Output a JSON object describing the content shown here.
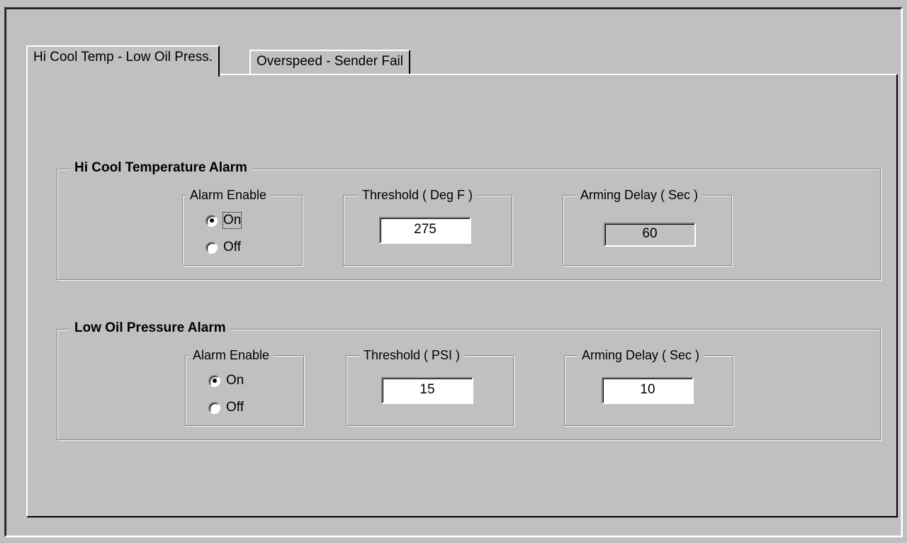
{
  "tabs": [
    {
      "label": "Hi Cool Temp - Low Oil Press.",
      "active": true
    },
    {
      "label": "Overspeed - Sender Fail",
      "active": false
    }
  ],
  "groups": {
    "hi_cool": {
      "title": "Hi Cool Temperature Alarm",
      "alarm_enable": {
        "label": "Alarm Enable",
        "on_label": "On",
        "off_label": "Off",
        "selected": "On"
      },
      "threshold": {
        "label": "Threshold ( Deg F )",
        "value": "275"
      },
      "arming_delay": {
        "label": "Arming Delay ( Sec )",
        "value": "60",
        "enabled": false
      }
    },
    "low_oil": {
      "title": "Low Oil Pressure Alarm",
      "alarm_enable": {
        "label": "Alarm Enable",
        "on_label": "On",
        "off_label": "Off",
        "selected": "On"
      },
      "threshold": {
        "label": "Threshold ( PSI )",
        "value": "15"
      },
      "arming_delay": {
        "label": "Arming Delay ( Sec )",
        "value": "10",
        "enabled": true
      }
    }
  },
  "colors": {
    "face": "#c0c0c0",
    "shadow": "#808080",
    "highlight": "#ffffff",
    "dark": "#000000"
  }
}
